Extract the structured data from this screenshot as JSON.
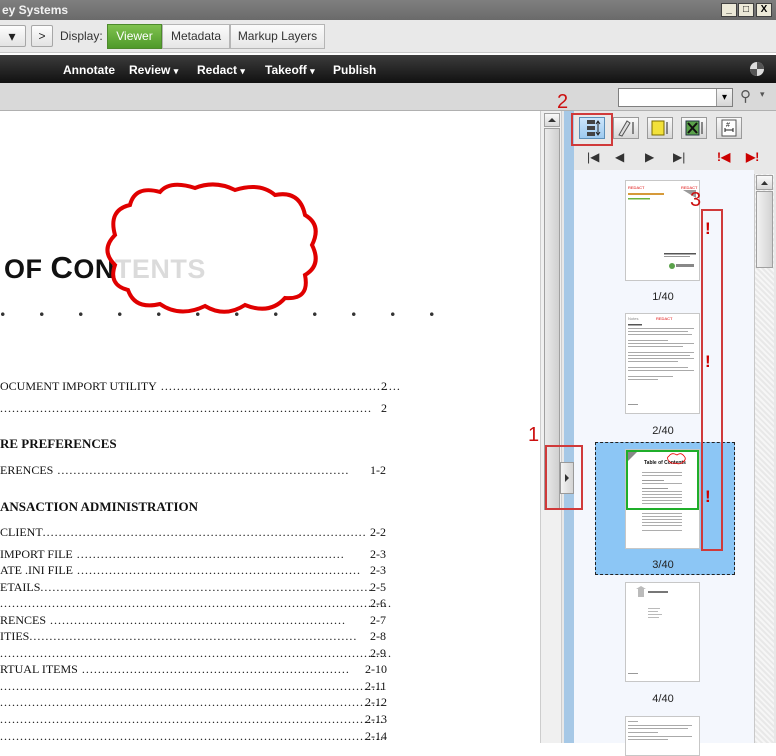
{
  "window": {
    "title": "ey Systems",
    "minimize": "_",
    "maximize": "□",
    "close": "X"
  },
  "displaybar": {
    "dropdown_arrow": "▾",
    "next_button": ">",
    "display_label": "Display:",
    "tabs": [
      {
        "label": "Viewer",
        "active": true
      },
      {
        "label": "Metadata"
      },
      {
        "label": "Markup Layers"
      }
    ]
  },
  "menubar": {
    "items": [
      {
        "label": "Annotate"
      },
      {
        "label": "Review",
        "arrow": "▾"
      },
      {
        "label": "Redact",
        "arrow": "▾"
      },
      {
        "label": "Takeoff",
        "arrow": "▾"
      },
      {
        "label": "Publish"
      }
    ]
  },
  "search": {
    "dropdown_arrow": "▾",
    "icon": "⚲",
    "icon_arrow": "▾"
  },
  "document": {
    "heading_of": "OF",
    "heading_co": "C",
    "heading_ntents": "O",
    "heading_rest": "NTENTS",
    "leader_dots": ". . . . . . . . . . . .",
    "entries": [
      {
        "text": "OCUMENT IMPORT UTILITY",
        "page": "2"
      },
      {
        "text": "",
        "page": "2"
      },
      {
        "section": "RE PREFERENCES"
      },
      {
        "text": "ERENCES",
        "page": "1-2"
      },
      {
        "section": "ANSACTION ADMINISTRATION"
      },
      {
        "text": "CLIENT",
        "page": "2-2"
      },
      {
        "text": " IMPORT FILE",
        "page": "2-3"
      },
      {
        "text": "ATE .INI FILE",
        "page": "2-3"
      },
      {
        "text": "ETAILS",
        "page": "2-5"
      },
      {
        "text": "",
        "page": "2-6"
      },
      {
        "text": "RENCES",
        "page": "2-7"
      },
      {
        "text": "ITIES",
        "page": "2-8"
      },
      {
        "text": "",
        "page": "2-9"
      },
      {
        "text": "RTUAL ITEMS",
        "page": "2-10"
      },
      {
        "text": "",
        "page": "2-11"
      },
      {
        "text": "",
        "page": "2-12"
      },
      {
        "text": "",
        "page": "2-13"
      },
      {
        "text": "",
        "page": "2-14"
      }
    ]
  },
  "thumbnails": {
    "labels": [
      "1/40",
      "2/40",
      "3/40",
      "4/40"
    ],
    "nav": {
      "first": "|◀",
      "prev": "◀",
      "next": "▶",
      "last": "▶|",
      "flag_prev": "!◀",
      "flag_next": "▶!"
    },
    "flag": "!"
  },
  "annotations": {
    "one": "1",
    "two": "2",
    "three": "3"
  },
  "colors": {
    "accent_green": "#6cb33f",
    "annotation_red": "#d03a3a",
    "selected_blue": "#8cc6f5"
  }
}
